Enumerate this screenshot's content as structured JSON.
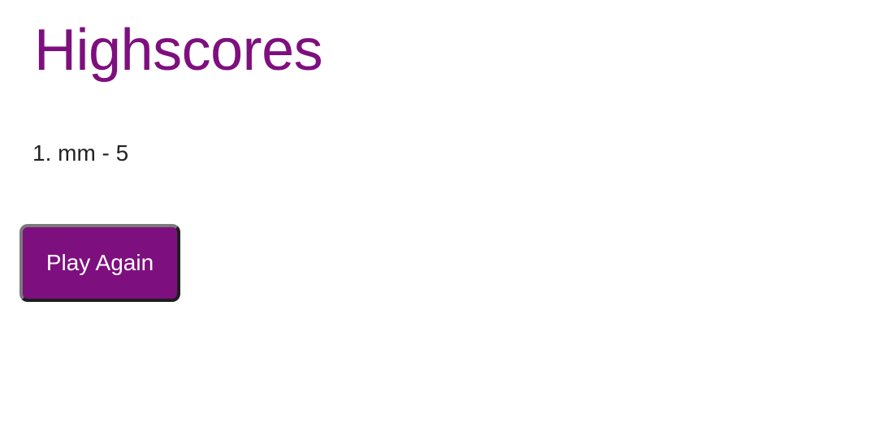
{
  "page": {
    "title": "Highscores"
  },
  "highscores": {
    "items": [
      {
        "text": "1. mm - 5"
      }
    ]
  },
  "actions": {
    "play_again_label": "Play Again"
  },
  "colors": {
    "accent": "#7e0f7e",
    "text": "#222222",
    "background": "#ffffff"
  }
}
